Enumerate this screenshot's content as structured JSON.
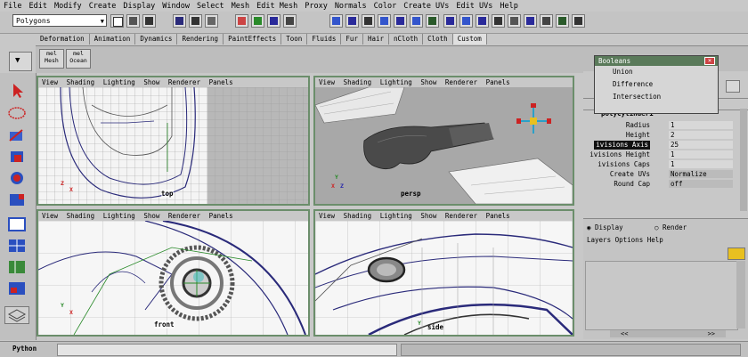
{
  "menu": [
    "File",
    "Edit",
    "Modify",
    "Create",
    "Display",
    "Window",
    "Select",
    "Mesh",
    "Edit Mesh",
    "Proxy",
    "Normals",
    "Color",
    "Create UVs",
    "Edit UVs",
    "Help"
  ],
  "status_line": {
    "mode": "Polygons"
  },
  "shelf_tabs": [
    "Deformation",
    "Animation",
    "Dynamics",
    "Rendering",
    "PaintEffects",
    "Toon",
    "Fluids",
    "Fur",
    "Hair",
    "nCloth",
    "Cloth",
    "Custom"
  ],
  "shelf_active": "Custom",
  "shelf_buttons": [
    {
      "line1": "mel",
      "line2": "Mesh"
    },
    {
      "line1": "mel",
      "line2": "Ocean"
    }
  ],
  "viewport_menu": [
    "View",
    "Shading",
    "Lighting",
    "Show",
    "Renderer",
    "Panels"
  ],
  "viewports": [
    {
      "camera": "top"
    },
    {
      "camera": "persp"
    },
    {
      "camera": "front"
    },
    {
      "camera": "side"
    }
  ],
  "boolean_menu": {
    "title": "Booleans",
    "items": [
      "Union",
      "Difference",
      "Intersection"
    ]
  },
  "attributes": {
    "section": "polyCylinder1",
    "rows": [
      {
        "label": "Radius",
        "value": "1"
      },
      {
        "label": "Height",
        "value": "2"
      },
      {
        "label": "ivisions Axis",
        "value": "25"
      },
      {
        "label": "ivisions Height",
        "value": "1"
      },
      {
        "label": "ivisions Caps",
        "value": "1"
      },
      {
        "label": "Create UVs",
        "value": "Normalize"
      },
      {
        "label": "Round Cap",
        "value": "off"
      }
    ]
  },
  "layer_editor": {
    "display_label": "Display",
    "render_label": "Render",
    "menu": [
      "Layers",
      "Options",
      "Help"
    ]
  },
  "command_line": {
    "language": "Python"
  },
  "colors": {
    "viewport_border": "#6b8e6b",
    "panel_bg": "#c8c8c8",
    "wire": "#2a2a7a"
  }
}
